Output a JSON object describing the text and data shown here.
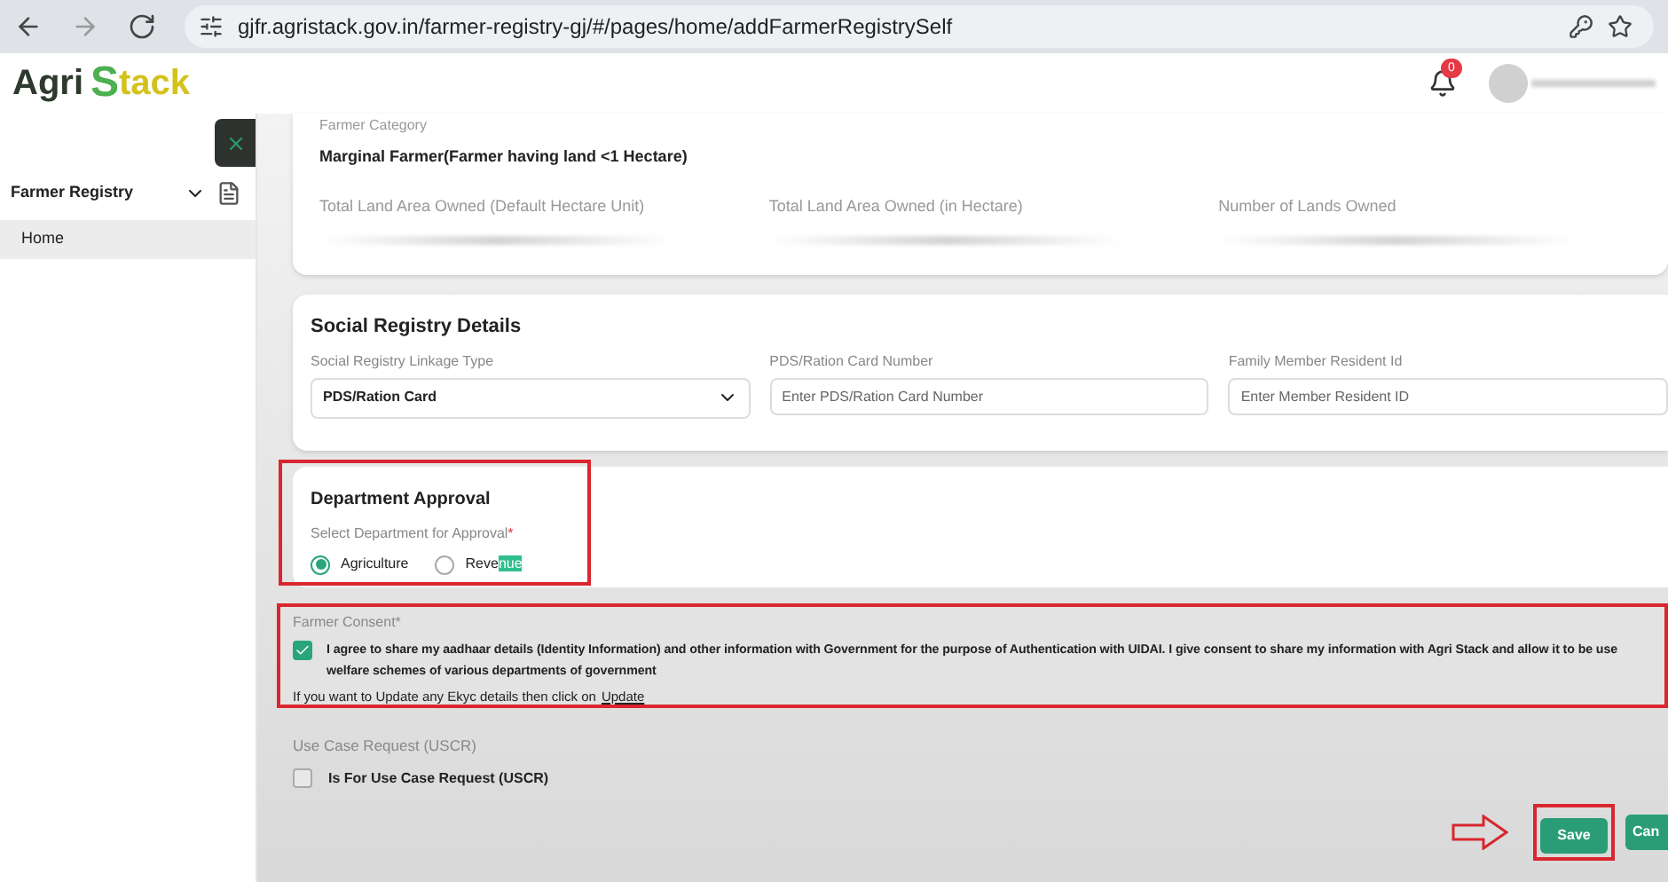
{
  "browser": {
    "url": "gjfr.agristack.gov.in/farmer-registry-gj/#/pages/home/addFarmerRegistrySelf"
  },
  "header": {
    "logo_left": "Agri",
    "logo_right": "tack",
    "logo_s": "S",
    "notification_count": "0"
  },
  "sidebar": {
    "items": [
      {
        "label": "Farmer Registry",
        "kind": "group",
        "expanded": true,
        "selected": false
      },
      {
        "label": "Home",
        "kind": "link",
        "selected": true
      }
    ]
  },
  "farmer_card": {
    "category_label": "Farmer Category",
    "category_value": "Marginal  Farmer(Farmer having land <1 Hectare)",
    "fields": [
      {
        "label": "Total Land Area Owned (Default Hectare Unit)"
      },
      {
        "label": "Total Land Area Owned (in Hectare)"
      },
      {
        "label": "Number of Lands Owned"
      }
    ]
  },
  "social_registry": {
    "title": "Social Registry Details",
    "fields": [
      {
        "label": "Social Registry Linkage Type",
        "kind": "select",
        "value": "PDS/Ration Card"
      },
      {
        "label": "PDS/Ration Card Number",
        "kind": "input",
        "placeholder": "Enter PDS/Ration Card Number"
      },
      {
        "label": "Family Member Resident Id",
        "kind": "input",
        "placeholder": "Enter Member Resident ID"
      }
    ]
  },
  "department_approval": {
    "title": "Department Approval",
    "question": "Select Department for Approval",
    "required_mark": "*",
    "options": [
      {
        "label": "Agriculture",
        "selected": true
      },
      {
        "label": "Reve",
        "highlighted_text": "nue",
        "selected": false
      }
    ]
  },
  "consent": {
    "label": "Farmer Consent",
    "required_mark": "*",
    "checked": true,
    "text": "I agree to share my aadhaar details (Identity Information) and other information with Government for the purpose of Authentication with UIDAI. I give consent to share my information with Agri Stack and allow it to be use",
    "text_line2": "welfare schemes of various departments of government",
    "update_text": "If you want to Update any Ekyc details then click on",
    "update_link": "Update"
  },
  "uscr": {
    "label": "Use Case Request (USCR)",
    "checkbox_label": "Is For Use Case Request (USCR)",
    "checked": false
  },
  "buttons": [
    {
      "label": "Save",
      "kind": "save"
    },
    {
      "label": "Can",
      "kind": "cancel"
    }
  ]
}
